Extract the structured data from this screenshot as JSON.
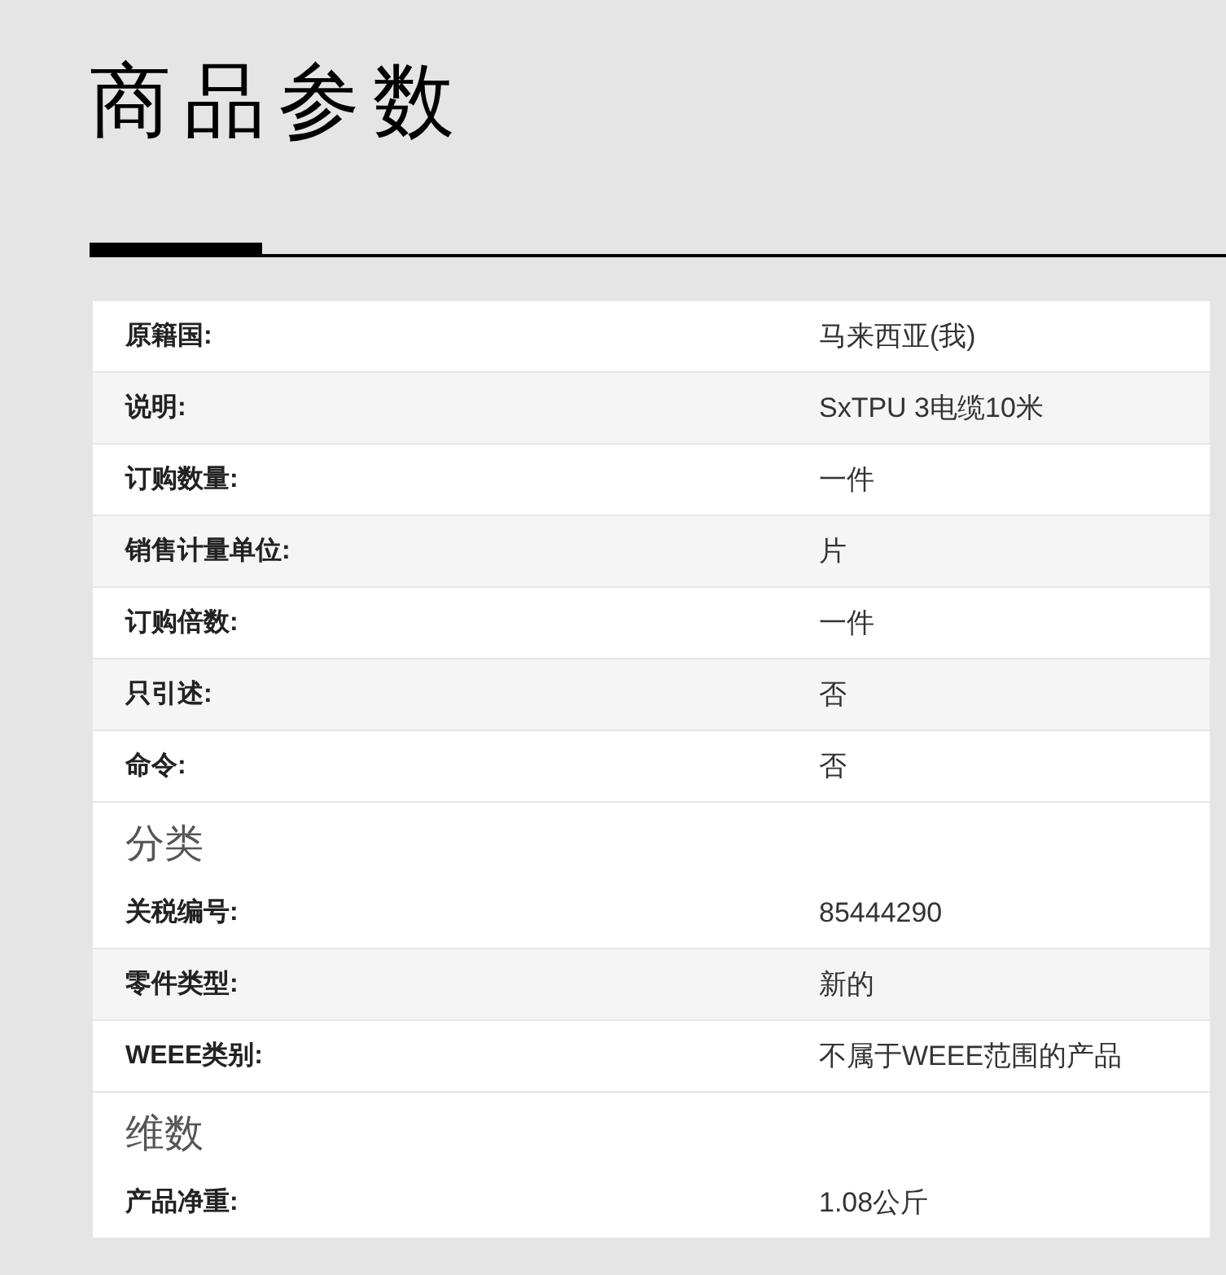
{
  "title": "商品参数",
  "groups": [
    {
      "rows": [
        {
          "label": "原籍国:",
          "value": "马来西亚(我)"
        },
        {
          "label": "说明:",
          "value": "SxTPU 3电缆10米"
        },
        {
          "label": "订购数量:",
          "value": "一件"
        },
        {
          "label": "销售计量单位:",
          "value": "片"
        },
        {
          "label": "订购倍数:",
          "value": "一件"
        },
        {
          "label": "只引述:",
          "value": "否"
        },
        {
          "label": "命令:",
          "value": "否"
        }
      ]
    },
    {
      "heading": "分类",
      "rows": [
        {
          "label": "关税编号:",
          "value": "85444290"
        },
        {
          "label": "零件类型:",
          "value": "新的"
        },
        {
          "label": "WEEE类别:",
          "value": "不属于WEEE范围的产品"
        }
      ]
    },
    {
      "heading": "维数",
      "rows": [
        {
          "label": "产品净重:",
          "value": "1.08公斤"
        }
      ]
    }
  ]
}
